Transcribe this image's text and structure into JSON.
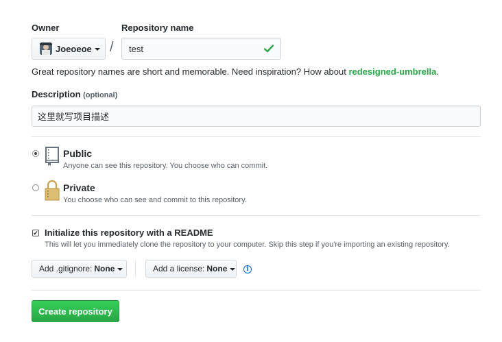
{
  "owner": {
    "label": "Owner",
    "value": "Joeoeoe"
  },
  "repository": {
    "label": "Repository name",
    "value": "test",
    "separator": "/"
  },
  "hint": {
    "text": "Great repository names are short and memorable. Need inspiration? How about ",
    "suggestion": "redesigned-umbrella",
    "end": "."
  },
  "description": {
    "label": "Description",
    "optional": "(optional)",
    "value": "这里就写项目描述"
  },
  "visibility": {
    "public": {
      "title": "Public",
      "subtitle": "Anyone can see this repository. You choose who can commit.",
      "selected": true
    },
    "private": {
      "title": "Private",
      "subtitle": "You choose who can see and commit to this repository.",
      "selected": false
    }
  },
  "readme": {
    "title": "Initialize this repository with a README",
    "subtitle": "This will let you immediately clone the repository to your computer. Skip this step if you're importing an existing repository.",
    "checked": true
  },
  "gitignore": {
    "label": "Add .gitignore:",
    "value": "None"
  },
  "license": {
    "label": "Add a license:",
    "value": "None"
  },
  "submit": {
    "label": "Create repository"
  },
  "colors": {
    "accent_green": "#28a745",
    "link_blue": "#0366d6",
    "border": "#d1d5da"
  }
}
